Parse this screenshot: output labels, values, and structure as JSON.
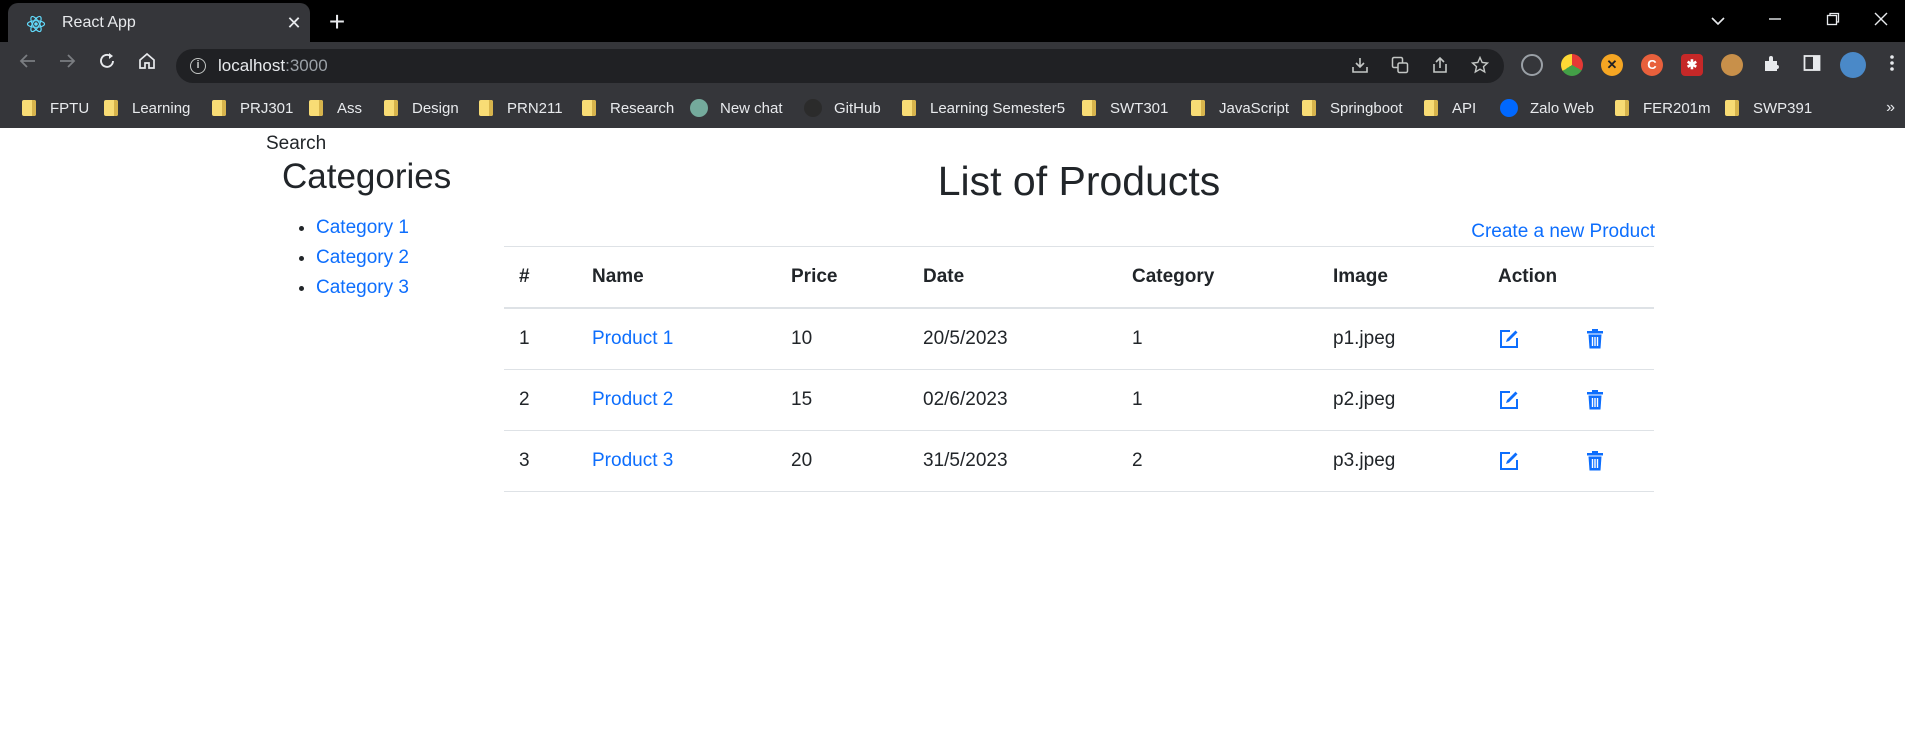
{
  "browser": {
    "tab_title": "React App",
    "tab_close": "✕",
    "new_tab": "+",
    "url_host": "localhost",
    "url_port": ":3000",
    "bookmarks": [
      {
        "label": "FPTU",
        "type": "folder"
      },
      {
        "label": "Learning",
        "type": "folder"
      },
      {
        "label": "PRJ301",
        "type": "folder"
      },
      {
        "label": "Ass",
        "type": "folder"
      },
      {
        "label": "Design",
        "type": "folder"
      },
      {
        "label": "PRN211",
        "type": "folder"
      },
      {
        "label": "Research",
        "type": "folder"
      },
      {
        "label": "New chat",
        "type": "site"
      },
      {
        "label": "GitHub",
        "type": "site"
      },
      {
        "label": "Learning Semester5",
        "type": "folder"
      },
      {
        "label": "SWT301",
        "type": "folder"
      },
      {
        "label": "JavaScript",
        "type": "folder"
      },
      {
        "label": "Springboot",
        "type": "folder"
      },
      {
        "label": "API",
        "type": "folder"
      },
      {
        "label": "Zalo Web",
        "type": "site"
      },
      {
        "label": "FER201m",
        "type": "folder"
      },
      {
        "label": "SWP391",
        "type": "folder"
      }
    ],
    "bookmarks_more": "»"
  },
  "sidebar": {
    "search_label": "Search",
    "title": "Categories",
    "categories": [
      "Category 1",
      "Category 2",
      "Category 3"
    ]
  },
  "main": {
    "title": "List of Products",
    "create_link": "Create a new Product",
    "columns": [
      "#",
      "Name",
      "Price",
      "Date",
      "Category",
      "Image",
      "Action"
    ],
    "rows": [
      {
        "id": "1",
        "name": "Product 1",
        "price": "10",
        "date": "20/5/2023",
        "category": "1",
        "image": "p1.jpeg"
      },
      {
        "id": "2",
        "name": "Product 2",
        "price": "15",
        "date": "02/6/2023",
        "category": "1",
        "image": "p2.jpeg"
      },
      {
        "id": "3",
        "name": "Product 3",
        "price": "20",
        "date": "31/5/2023",
        "category": "2",
        "image": "p3.jpeg"
      }
    ]
  },
  "colors": {
    "link": "#0d6efd",
    "text": "#212529"
  }
}
